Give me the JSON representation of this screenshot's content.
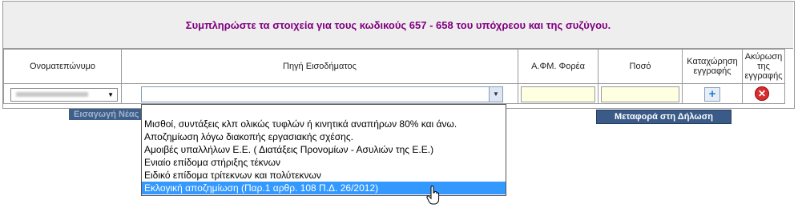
{
  "header": {
    "title": "Συμπληρώστε τα στοιχεία για τους κωδικούς 657 - 658 του υπόχρεου και της συζύγου."
  },
  "table": {
    "headers": {
      "name": "Ονοματεπώνυμο",
      "source": "Πηγή Εισοδήματος",
      "afm": "Α.ΦΜ. Φορέα",
      "amount": "Ποσό",
      "register": "Καταχώρηση εγγραφής",
      "cancel": "Ακύρωση της εγγραφής"
    },
    "row": {
      "name_value": "",
      "source_value": "",
      "afm_value": "",
      "amount_value": ""
    }
  },
  "buttons": {
    "insert_new": "Εισαγωγή Νέας",
    "transfer": "Μεταφορά στη Δήλωση"
  },
  "dropdown": {
    "options": [
      "",
      "Μισθοί, συντάξεις κλπ ολικώς τυφλών ή κινητικά αναπήρων 80% και άνω.",
      "Αποζημίωση λόγω διακοπής εργασιακής σχέσης.",
      "Αμοιβές υπαλλήλων Ε.Ε. ( Διατάξεις Προνομίων - Ασυλιών της Ε.Ε.)",
      "Ενιαίο επίδομα στήριξης τέκνων",
      "Ειδικό επίδομα τρίτεκνων και πολύτεκνων",
      "Εκλογική αποζημίωση (Παρ.1 αρθρ. 108 Π.Δ. 26/2012)"
    ],
    "selected_index": 6
  },
  "colors": {
    "title": "#800080",
    "highlight": "#3399ff",
    "button": "#3a5a88",
    "input_bg": "#ffffe1"
  },
  "icons": {
    "add": "plus-icon",
    "cancel": "close-icon",
    "caret": "chevron-down-icon",
    "cursor": "hand-cursor-icon"
  }
}
